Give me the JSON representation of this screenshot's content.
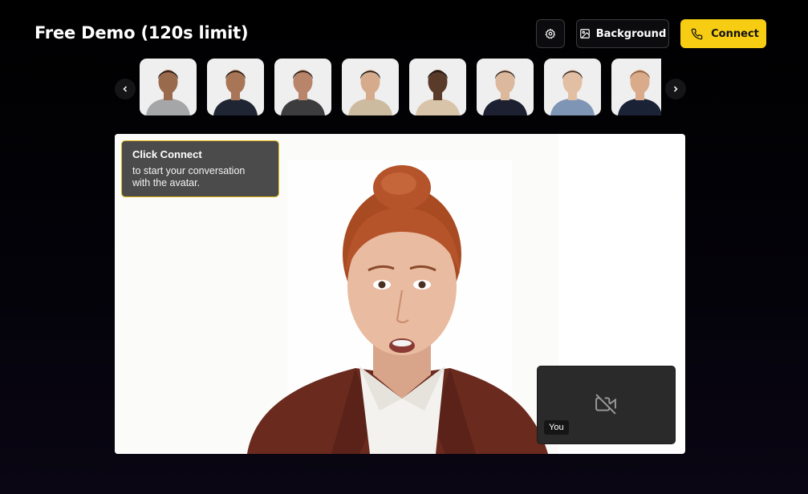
{
  "header": {
    "title": "Free Demo (120s limit)",
    "background_label": "Background",
    "connect_label": "Connect"
  },
  "icons": {
    "settings": "gear-icon",
    "background": "image-icon",
    "connect": "phone-icon",
    "prev": "chevron-left-icon",
    "next": "chevron-right-icon",
    "camera": "camera-off-icon"
  },
  "avatars": [
    {
      "skin": "#9a6a4c",
      "hair": "#1b1410",
      "shirt": "#a4a6a8",
      "bg": "#efefef"
    },
    {
      "skin": "#a87656",
      "hair": "#1a1410",
      "shirt": "#1f2533",
      "bg": "#efefef"
    },
    {
      "skin": "#b8846a",
      "hair": "#1a1412",
      "shirt": "#3c3c3e",
      "bg": "#efefef"
    },
    {
      "skin": "#d6ab8c",
      "hair": "#151312",
      "shirt": "#cdbba0",
      "bg": "#efefef"
    },
    {
      "skin": "#5a3a28",
      "hair": "#161210",
      "shirt": "#d8c4a8",
      "bg": "#efefef"
    },
    {
      "skin": "#dcb89d",
      "hair": "#2a1e18",
      "shirt": "#1c2030",
      "bg": "#efefef"
    },
    {
      "skin": "#e2bea3",
      "hair": "#2e2520",
      "shirt": "#7e95b5",
      "bg": "#efefef"
    },
    {
      "skin": "#d9ab8b",
      "hair": "#8a5a38",
      "shirt": "#1a2236",
      "bg": "#efefef"
    }
  ],
  "tooltip": {
    "title": "Click Connect",
    "body_line1": "to start your conversation",
    "body_line2": "with the avatar."
  },
  "self_view": {
    "label": "You"
  },
  "colors": {
    "accent": "#f7cd14",
    "jacket": "#6b2a1e",
    "hair": "#b5532a"
  }
}
